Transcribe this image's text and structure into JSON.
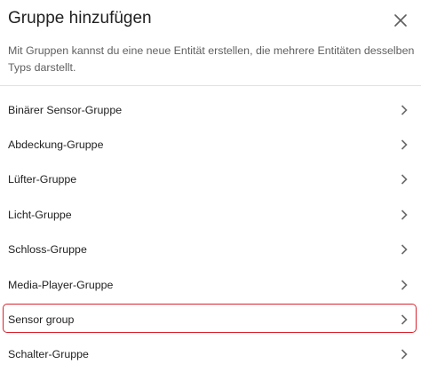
{
  "dialog": {
    "title": "Gruppe hinzufügen",
    "close_icon": "close-icon",
    "description": "Mit Gruppen kannst du eine neue Entität erstellen, die mehrere Entitäten desselben Typs darstellt."
  },
  "groups": [
    {
      "label": "Binärer Sensor-Gruppe",
      "icon": "chevron-right-icon"
    },
    {
      "label": "Abdeckung-Gruppe",
      "icon": "chevron-right-icon"
    },
    {
      "label": "Lüfter-Gruppe",
      "icon": "chevron-right-icon"
    },
    {
      "label": "Licht-Gruppe",
      "icon": "chevron-right-icon"
    },
    {
      "label": "Schloss-Gruppe",
      "icon": "chevron-right-icon"
    },
    {
      "label": "Media-Player-Gruppe",
      "icon": "chevron-right-icon"
    },
    {
      "label": "Sensor group",
      "icon": "chevron-right-icon"
    },
    {
      "label": "Schalter-Gruppe",
      "icon": "chevron-right-icon"
    }
  ],
  "colors": {
    "highlight_border": "#d9232e",
    "divider": "#e0e0e0",
    "text_primary": "#212121",
    "text_secondary": "#5f5f5f"
  }
}
